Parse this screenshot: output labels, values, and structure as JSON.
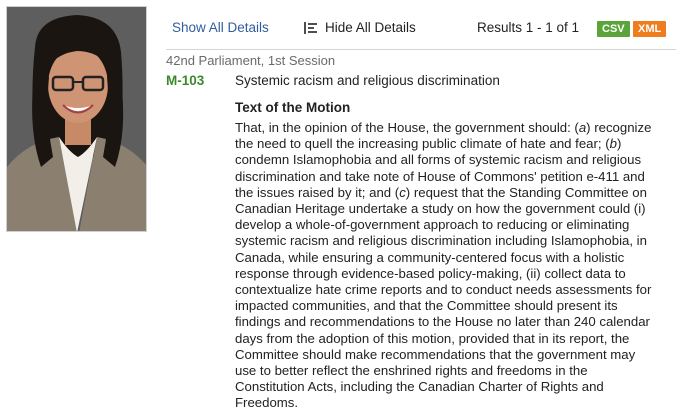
{
  "toolbar": {
    "show_all_label": "Show All Details",
    "hide_all_label": "Hide All Details",
    "results_text": "Results 1 - 1 of 1",
    "csv_label": "CSV",
    "xml_label": "XML"
  },
  "motion": {
    "session": "42nd Parliament, 1st Session",
    "id": "M-103",
    "title": "Systemic racism and religious discrimination",
    "section_heading": "Text of the Motion",
    "text_parts": [
      "That, in the opinion of the House, the government should: (",
      "a",
      ") recognize the need to quell the increasing public climate of hate and fear; (",
      "b",
      ") condemn Islamophobia and all forms of systemic racism and religious discrimination and take note of House of Commons' petition e-411 and the issues raised by it; and (",
      "c",
      ") request that the Standing Committee on Canadian Heritage undertake a study on how the government could (i) develop a whole-of-government approach to reducing or eliminating systemic racism and religious discrimination including Islamophobia, in Canada, while ensuring a community-centered focus with a holistic response through evidence-based policy-making, (ii) collect data to contextualize hate crime reports and to conduct needs assessments for impacted communities, and that the Committee should present its findings and recommendations to the House no later than 240 calendar days from the adoption of this motion, provided that in its report, the Committee should make recommendations that the government may use to better reflect the enshrined rights and freedoms in the Constitution Acts, including the Canadian Charter of Rights and Freedoms."
    ]
  },
  "icons": {
    "hide_all": "collapse-icon"
  },
  "colors": {
    "link": "#2f5e9e",
    "motion_id": "#3b8a2a",
    "csv_badge": "#5aa43a",
    "xml_badge": "#ef7c1d"
  }
}
